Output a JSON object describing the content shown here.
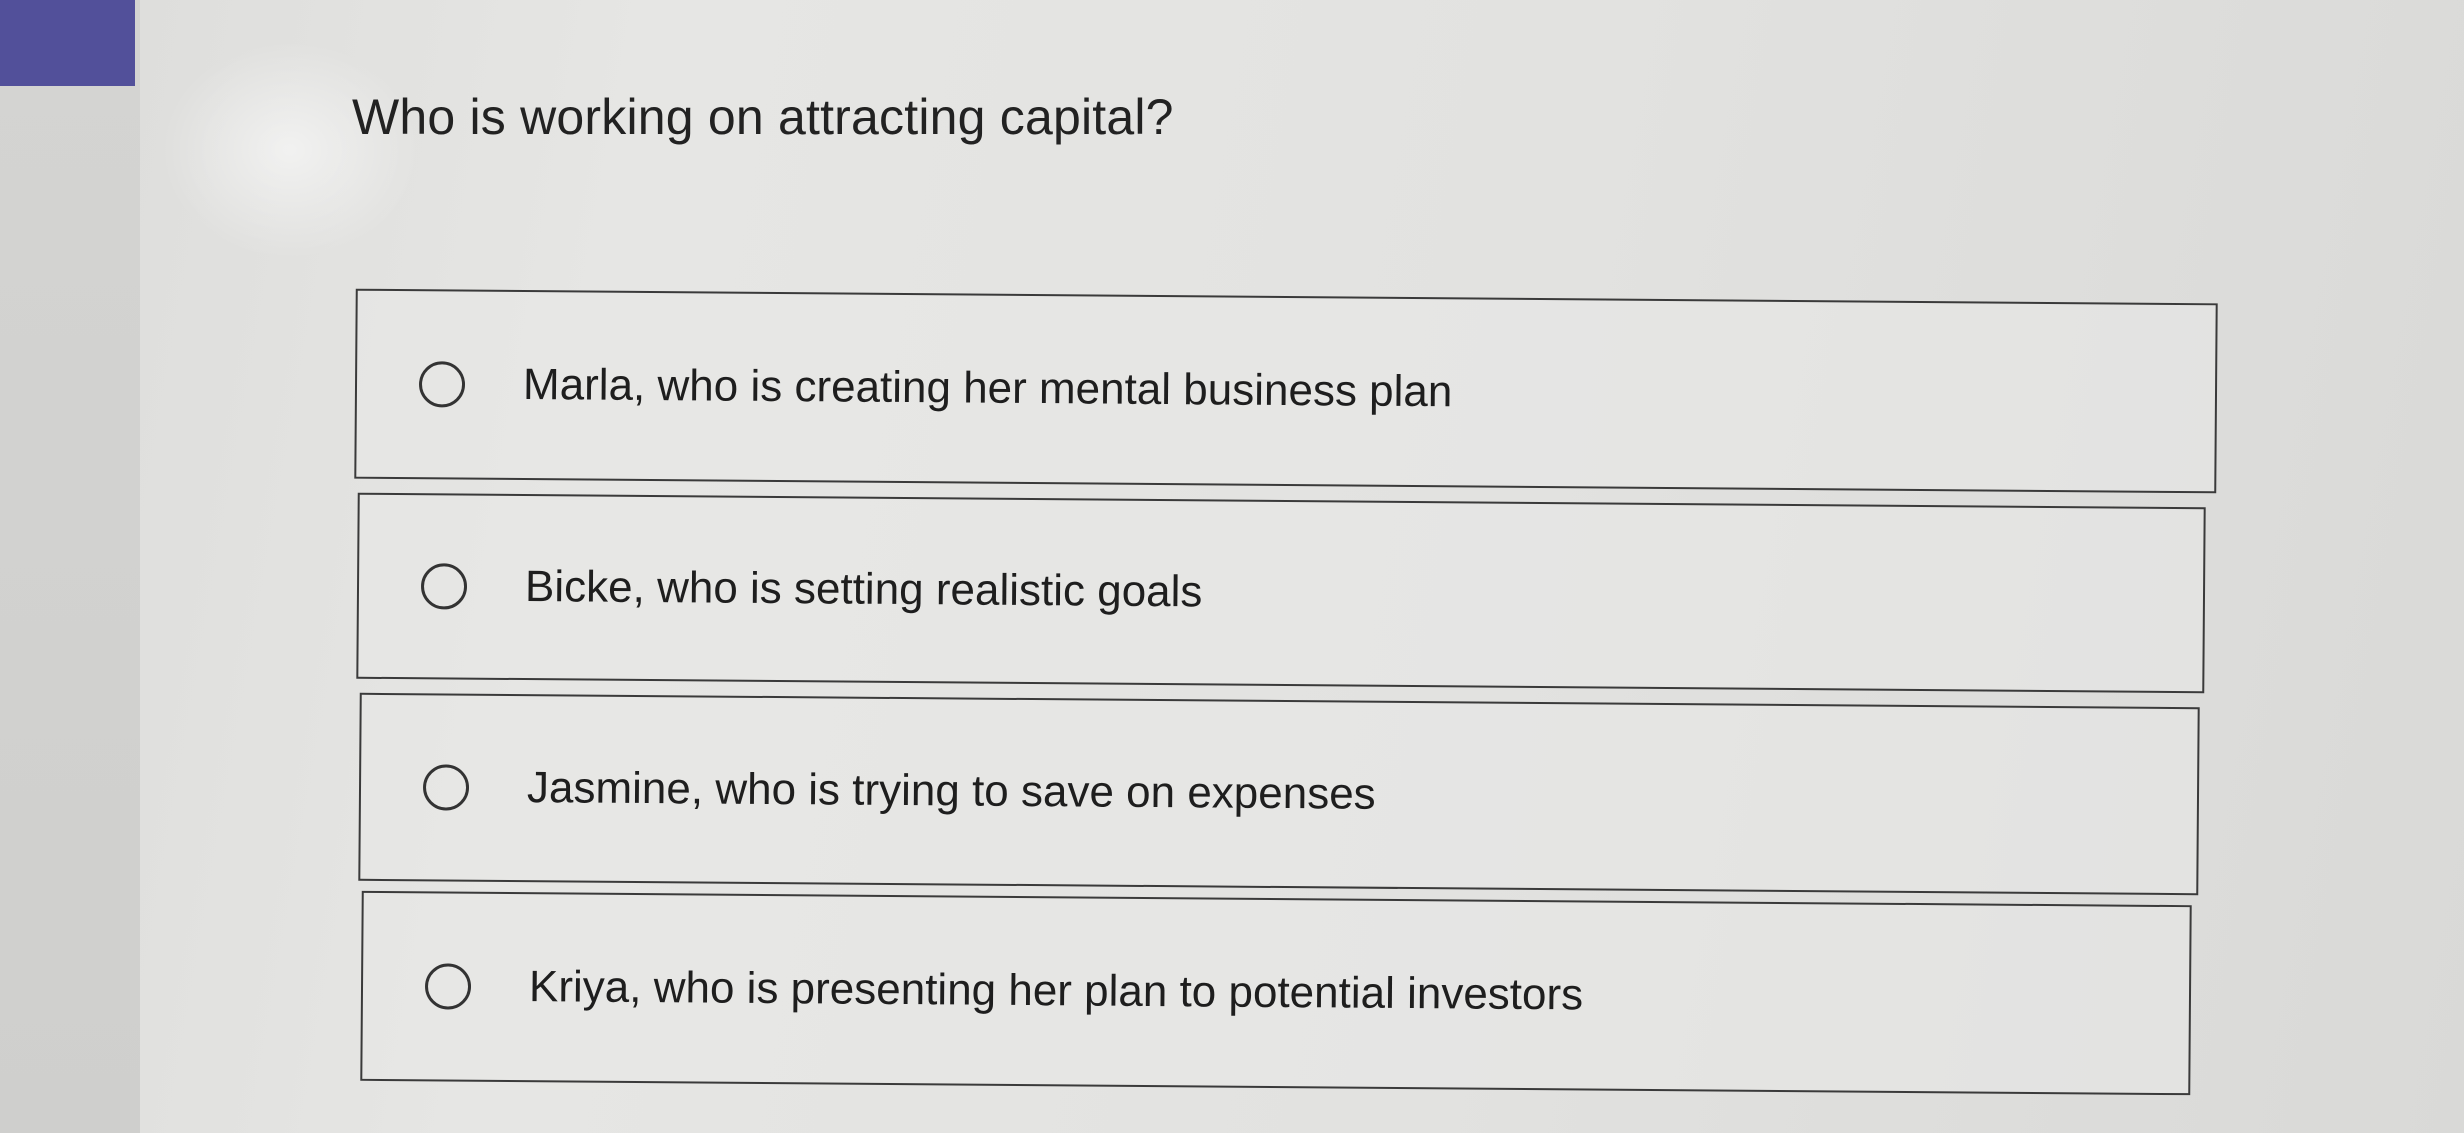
{
  "question": {
    "text": "Who is working on attracting capital?"
  },
  "options": [
    {
      "label": "Marla, who is creating her mental business plan",
      "selected": false
    },
    {
      "label": "Bicke, who is setting realistic goals",
      "selected": false
    },
    {
      "label": "Jasmine, who is trying to save on expenses",
      "selected": false
    },
    {
      "label": "Kriya, who is presenting her plan to potential investors",
      "selected": false
    }
  ],
  "colors": {
    "accent": "#52509a",
    "border": "#3a3a3a",
    "text": "#222222"
  },
  "icons": {
    "radio": "radio-unchecked-icon"
  }
}
